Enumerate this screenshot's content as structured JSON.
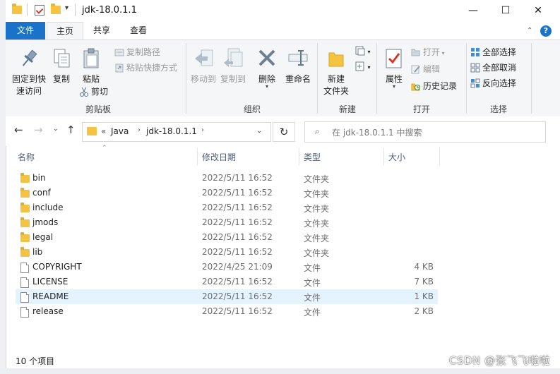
{
  "window": {
    "title": "jdk-18.0.1.1",
    "controls": {
      "minimize": "—",
      "maximize": "☐",
      "close": "✕"
    }
  },
  "tabs": [
    {
      "label": "文件"
    },
    {
      "label": "主页"
    },
    {
      "label": "共享"
    },
    {
      "label": "查看"
    }
  ],
  "ribbon": {
    "clipboard": {
      "group_label": "剪贴板",
      "pin_label_1": "固定到快",
      "pin_label_2": "速访问",
      "copy": "复制",
      "paste": "粘贴",
      "cut": "剪切",
      "copy_path": "复制路径",
      "paste_shortcut": "粘贴快捷方式"
    },
    "organize": {
      "group_label": "组织",
      "move_to": "移动到",
      "copy_to": "复制到",
      "delete": "删除",
      "rename": "重命名"
    },
    "new": {
      "group_label": "新建",
      "new_folder_1": "新建",
      "new_folder_2": "文件夹"
    },
    "open": {
      "group_label": "打开",
      "properties": "属性",
      "open": "打开",
      "edit": "编辑",
      "history": "历史记录"
    },
    "select": {
      "group_label": "选择",
      "select_all": "全部选择",
      "select_none": "全部取消",
      "invert": "反向选择"
    },
    "help_glyph": "?"
  },
  "address": {
    "chevrons": "«",
    "crumbs": [
      "Java",
      "jdk-18.0.1.1"
    ],
    "search_placeholder": "在 jdk-18.0.1.1 中搜索"
  },
  "columns": {
    "name": "名称",
    "modified": "修改日期",
    "type": "类型",
    "size": "大小"
  },
  "files": [
    {
      "name": "bin",
      "modified": "2022/5/11 16:52",
      "type": "文件夹",
      "size": "",
      "kind": "folder"
    },
    {
      "name": "conf",
      "modified": "2022/5/11 16:52",
      "type": "文件夹",
      "size": "",
      "kind": "folder"
    },
    {
      "name": "include",
      "modified": "2022/5/11 16:52",
      "type": "文件夹",
      "size": "",
      "kind": "folder"
    },
    {
      "name": "jmods",
      "modified": "2022/5/11 16:52",
      "type": "文件夹",
      "size": "",
      "kind": "folder"
    },
    {
      "name": "legal",
      "modified": "2022/5/11 16:52",
      "type": "文件夹",
      "size": "",
      "kind": "folder"
    },
    {
      "name": "lib",
      "modified": "2022/5/11 16:52",
      "type": "文件夹",
      "size": "",
      "kind": "folder"
    },
    {
      "name": "COPYRIGHT",
      "modified": "2022/4/25 21:09",
      "type": "文件",
      "size": "4 KB",
      "kind": "file"
    },
    {
      "name": "LICENSE",
      "modified": "2022/5/11 16:52",
      "type": "文件",
      "size": "7 KB",
      "kind": "file"
    },
    {
      "name": "README",
      "modified": "2022/5/11 16:52",
      "type": "文件",
      "size": "1 KB",
      "kind": "file",
      "selected": true
    },
    {
      "name": "release",
      "modified": "2022/5/11 16:52",
      "type": "文件",
      "size": "2 KB",
      "kind": "file"
    }
  ],
  "status": {
    "count": "10 个项目"
  },
  "watermark": "CSDN @张飞飞啦啦",
  "colors": {
    "accent": "#1a73c8",
    "folder": "#f5c342",
    "selected_row": "#e5f3ff"
  }
}
